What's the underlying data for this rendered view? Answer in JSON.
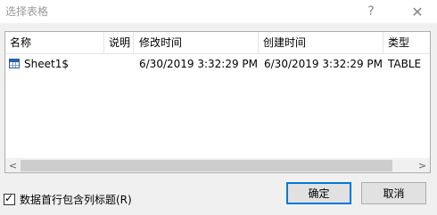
{
  "window": {
    "title": "选择表格",
    "help_label": "?",
    "close_label": "✕"
  },
  "list": {
    "columns": [
      "名称",
      "说明",
      "修改时间",
      "创建时间",
      "类型"
    ],
    "rows": [
      {
        "name": "Sheet1$",
        "description": "",
        "modified": "6/30/2019 3:32:29 PM",
        "created": "6/30/2019 3:32:29 PM",
        "type": "TABLE",
        "icon": "table-icon"
      }
    ]
  },
  "scrollbar": {
    "left_arrow": "<",
    "right_arrow": ">"
  },
  "options": {
    "header_row_label": "数据首行包含列标题(R)",
    "header_row_checked": true
  },
  "buttons": {
    "ok": "确定",
    "cancel": "取消"
  }
}
